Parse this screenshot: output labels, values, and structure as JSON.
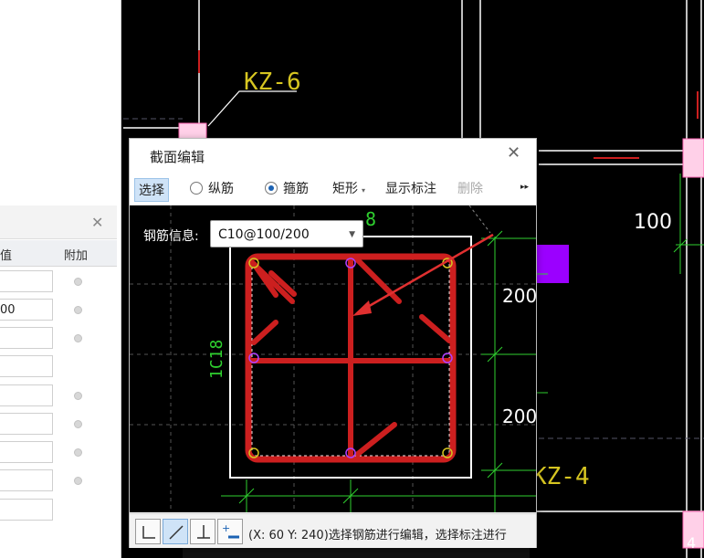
{
  "colors": {
    "background": "#000000",
    "rebar": "#cc1f1f",
    "dimension": "#2fd02f",
    "label_yellow": "#d6c521",
    "accent_purple": "#9b00ff"
  },
  "cad_labels": {
    "kz6": "KZ-6",
    "kz4": "KZ-4",
    "dim_100": "100",
    "dim_200_top": "200",
    "dim_200_bottom": "200",
    "side_bar": "1C18",
    "top_bar_partial": "8",
    "corner_num": "4"
  },
  "left_panel": {
    "col_value": "值",
    "col_extra": "附加",
    "rows": [
      {
        "value": "",
        "has_dot": true
      },
      {
        "value": "00",
        "has_dot": true
      },
      {
        "value": "",
        "has_dot": true
      },
      {
        "value": "",
        "has_dot": false
      },
      {
        "value": "",
        "has_dot": true
      },
      {
        "value": "",
        "has_dot": true
      },
      {
        "value": "",
        "has_dot": true
      },
      {
        "value": "",
        "has_dot": true
      }
    ]
  },
  "dialog": {
    "title": "截面编辑",
    "toolbar": {
      "select": "选择",
      "longitudinal": "纵筋",
      "stirrup": "箍筋",
      "shape": "矩形",
      "show_annotation": "显示标注",
      "delete": "删除",
      "more": "▸▸",
      "selected_radio": "stirrup"
    },
    "rebar_info_label": "钢筋信息:",
    "rebar_info_value": "C10@100/200",
    "status_text": "(X: 60 Y: 240)选择钢筋进行编辑，选择标注进行"
  }
}
